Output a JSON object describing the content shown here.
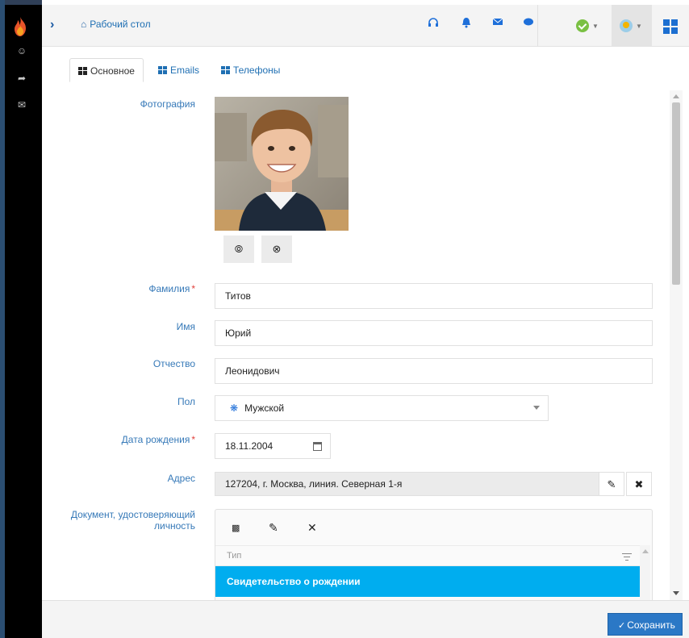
{
  "topbar": {
    "breadcrumb": "Рабочий стол"
  },
  "tabs": [
    {
      "label": "Основное",
      "active": true
    },
    {
      "label": "Emails",
      "active": false
    },
    {
      "label": "Телефоны",
      "active": false
    }
  ],
  "form": {
    "photo_label": "Фотография",
    "last_name": {
      "label": "Фамилия",
      "value": "Титов",
      "required": true
    },
    "first_name": {
      "label": "Имя",
      "value": "Юрий",
      "required": false
    },
    "patronymic": {
      "label": "Отчество",
      "value": "Леонидович",
      "required": false
    },
    "gender": {
      "label": "Пол",
      "value": "Мужской"
    },
    "birth_date": {
      "label": "Дата рождения",
      "value": "18.11.2004",
      "required": true
    },
    "address": {
      "label": "Адрес",
      "value": "127204, г. Москва, линия. Северная 1-я"
    },
    "document": {
      "label": "Документ, удостоверяющий личность",
      "column_type": "Тип",
      "rows": [
        "Свидетельство о рождении"
      ]
    }
  },
  "footer": {
    "save_label": "Сохранить"
  },
  "colors": {
    "accent": "#2b78c6",
    "selected_row": "#00adef",
    "label": "#3679b8",
    "required": "#e0413c",
    "status_ok": "#7ac043"
  },
  "icons": {
    "rail": [
      "flame-logo-icon",
      "badge-icon",
      "share-arrow-icon",
      "mail-icon"
    ],
    "topbar": [
      "headset-icon",
      "bell-icon",
      "mail-icon",
      "chat-icon",
      "status-ok-icon",
      "user-icon",
      "apps-grid-icon"
    ]
  }
}
